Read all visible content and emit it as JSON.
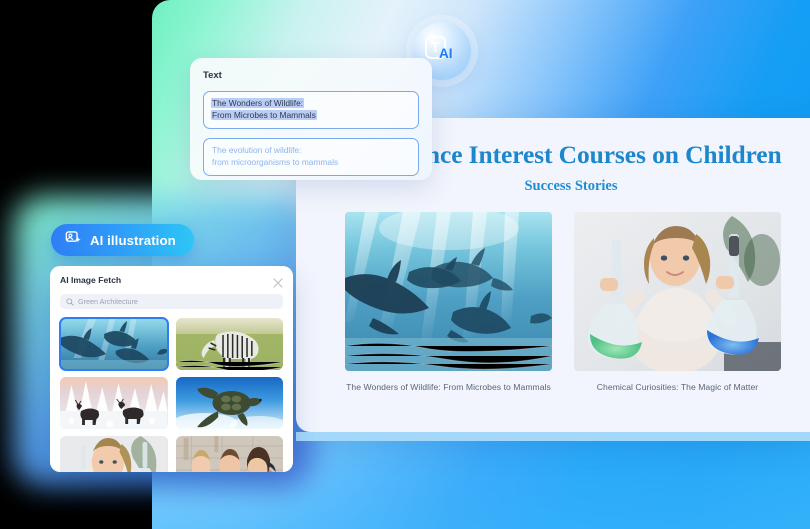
{
  "background": {
    "gradient_from": "#6ff0c0",
    "gradient_to": "#1ea7f2"
  },
  "ai_badge": {
    "name": "text-ai-badge",
    "letter": "T",
    "label": "AI",
    "letter_color": "#ffffff",
    "label_color": "#1f7df0"
  },
  "text_panel": {
    "title": "Text",
    "result_field": {
      "line1": "The Wonders of Wildlife:",
      "line2": "From Microbes to Mammals",
      "highlight_color": "#b9cdf6"
    },
    "prompt_field": {
      "line1": "The evolution of wildlife:",
      "line2": " from microorganisms to mammals",
      "placeholder_color": "#8fb3ef"
    }
  },
  "ai_pill": {
    "label": "AI illustration",
    "icon": "image-sparkle-icon",
    "gradient_from": "#2f7df5",
    "gradient_to": "#2ec7f5"
  },
  "fetch_panel": {
    "title": "AI Image Fetch",
    "close_icon": "close-icon",
    "search": {
      "icon": "search-icon",
      "placeholder": "Green Architecture",
      "value": ""
    },
    "thumbnails": [
      {
        "alt": "dolphins-underwater",
        "selected": true
      },
      {
        "alt": "zebra-grassland",
        "selected": false
      },
      {
        "alt": "reindeer-snow-forest",
        "selected": false
      },
      {
        "alt": "sea-turtle-swimming",
        "selected": false
      },
      {
        "alt": "child-with-flask",
        "selected": false
      },
      {
        "alt": "children-in-classroom",
        "selected": false
      }
    ]
  },
  "document": {
    "title": "Science Interest Courses on Children",
    "subtitle": "Success Stories",
    "title_color": "#1c87cc",
    "gallery": [
      {
        "alt": "dolphins-underwater",
        "caption": "The Wonders of Wildlife: From Microbes to Mammals"
      },
      {
        "alt": "child-holding-chemistry-flasks",
        "caption": "Chemical Curiosities: The Magic of Matter"
      }
    ]
  }
}
